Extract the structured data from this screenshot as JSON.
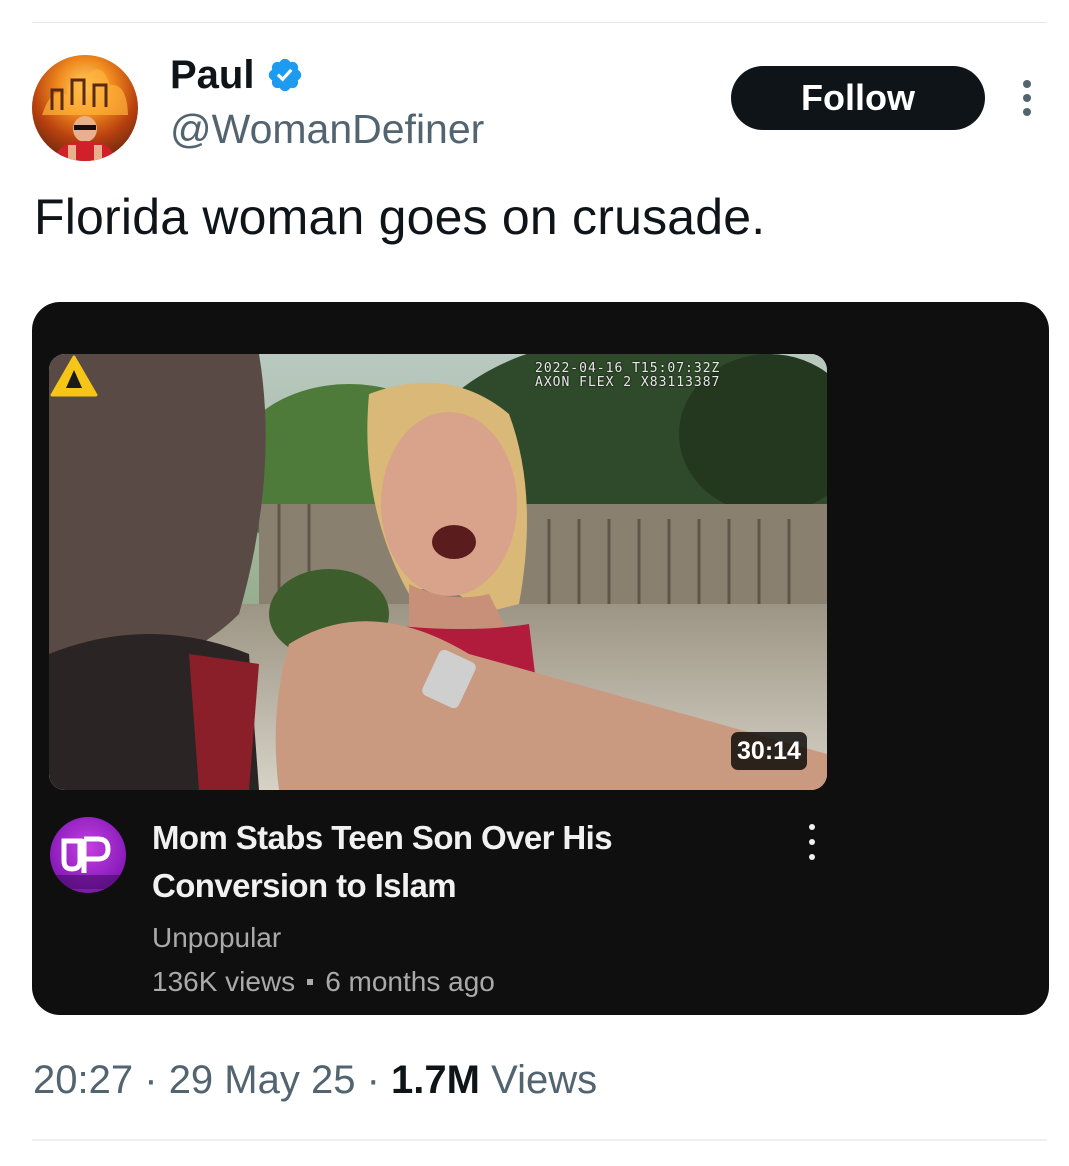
{
  "author": {
    "display_name": "Paul",
    "handle": "@WomanDefiner",
    "verified": true,
    "avatar_icon": "fire-avatar-icon"
  },
  "actions": {
    "follow_label": "Follow",
    "more_icon": "more-vertical-icon"
  },
  "tweet": {
    "text": "Florida woman goes on crusade."
  },
  "video_card": {
    "camera_overlay": "2022-04-16 T15:07:32Z\nAXON FLEX 2 X83113387",
    "duration": "30:14",
    "title": "Mom Stabs Teen Son Over His Conversion to Islam",
    "channel_name": "Unpopular",
    "channel_avatar_text": "UP",
    "views": "136K views",
    "age": "6 months ago"
  },
  "footer": {
    "time": "20:27",
    "date": "29 May 25",
    "separator": "·",
    "view_count": "1.7M",
    "views_label": "Views"
  },
  "colors": {
    "verified": "#1d9bf0",
    "follow_bg": "#0f1419",
    "card_bg": "#0f0f0f",
    "secondary_text": "#536471"
  }
}
